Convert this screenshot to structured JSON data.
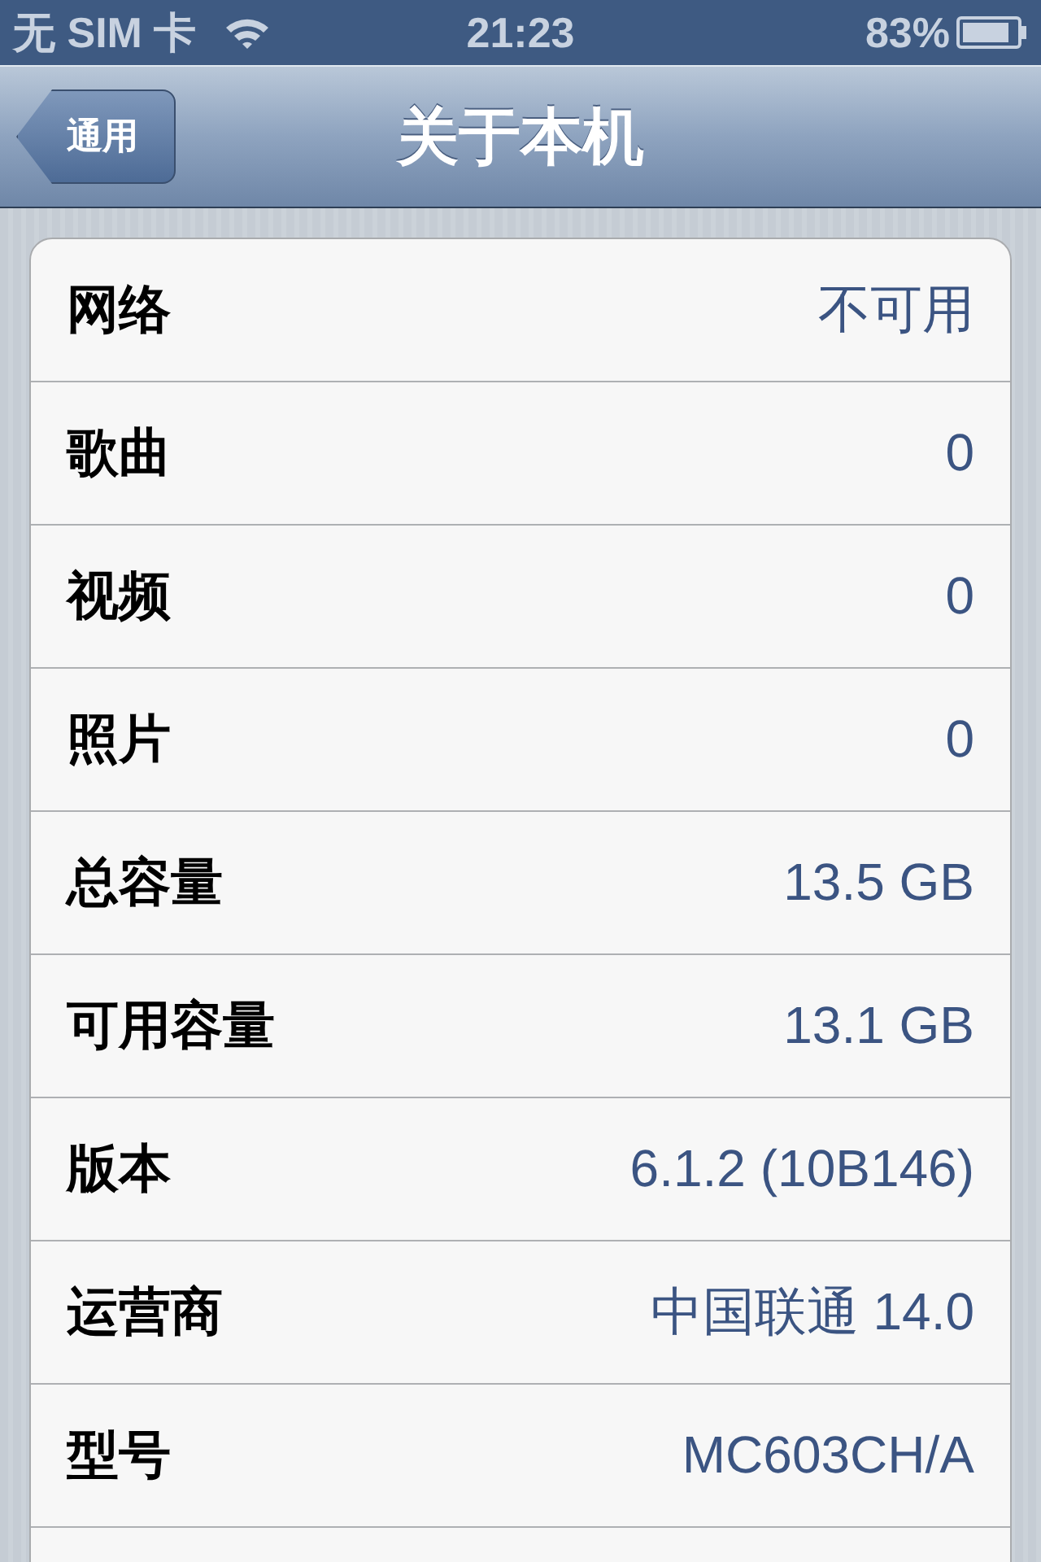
{
  "status_bar": {
    "carrier": "无 SIM 卡",
    "time": "21:23",
    "battery": "83%"
  },
  "nav_bar": {
    "back": "通用",
    "title": "关于本机"
  },
  "rows": [
    {
      "label": "网络",
      "value": "不可用"
    },
    {
      "label": "歌曲",
      "value": "0"
    },
    {
      "label": "视频",
      "value": "0"
    },
    {
      "label": "照片",
      "value": "0"
    },
    {
      "label": "总容量",
      "value": "13.5 GB"
    },
    {
      "label": "可用容量",
      "value": "13.1 GB"
    },
    {
      "label": "版本",
      "value": "6.1.2 (10B146)"
    },
    {
      "label": "运营商",
      "value": "中国联通 14.0"
    },
    {
      "label": "型号",
      "value": "MC603CH/A"
    }
  ]
}
